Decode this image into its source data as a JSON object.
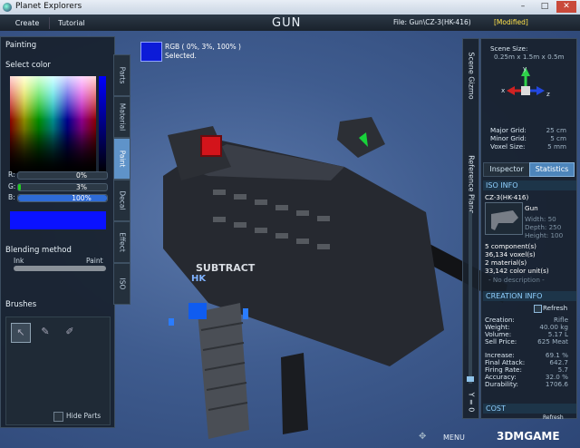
{
  "window": {
    "title": "Planet Explorers"
  },
  "toolbar": {
    "create_label": "Create",
    "tutorial_label": "Tutorial",
    "title": "GUN",
    "file": "File: Gun\\CZ-3(HK-416)",
    "modified": "[Modified]"
  },
  "color_info": {
    "rgb": "RGB ( 0%, 3%, 100% )",
    "status": "Selected."
  },
  "left_panel": {
    "title": "Painting",
    "select_color": "Select color",
    "r_label": "R:",
    "r_value": "0%",
    "r_level": 0,
    "g_label": "G:",
    "g_value": "3%",
    "g_level": 0.03,
    "b_label": "B:",
    "b_value": "100%",
    "b_level": 1.0,
    "selected_color": "#0a12ff",
    "blending_method": "Blending method",
    "ink_label": "Ink",
    "paint_label": "Paint",
    "brushes_label": "Brushes",
    "hide_parts_label": "Hide Parts"
  },
  "vertical_tabs": [
    "Parts",
    "Material",
    "Paint",
    "Decal",
    "Effect",
    "ISO"
  ],
  "active_tab": "Paint",
  "viewport": {
    "subtract_label": "SUBTRACT",
    "decal_text": "HK"
  },
  "gizmo_strip": {
    "scene_gizmo": "Scene Gizmo",
    "reference_plane": "Reference Plane",
    "y_value": "Y = 0"
  },
  "scene": {
    "scene_size_label": "Scene Size:",
    "scene_size_value": "0.25m x 1.5m x 0.5m",
    "axis_y": "y",
    "axis_x": "x",
    "axis_z": "z",
    "major_grid_label": "Major Grid:",
    "major_grid_value": "25 cm",
    "minor_grid_label": "Minor Grid:",
    "minor_grid_value": "5 cm",
    "voxel_size_label": "Voxel Size:",
    "voxel_size_value": "5 mm"
  },
  "right_tabs": {
    "inspector": "Inspector",
    "statistics": "Statistics"
  },
  "iso_info": {
    "header": "ISO INFO",
    "name": "CZ-3(HK-416)",
    "type": "Gun",
    "width": "Width: 50",
    "depth": "Depth: 250",
    "height": "Height: 100",
    "components": "5 component(s)",
    "voxels": "36,134 voxel(s)",
    "materials": "2 material(s)",
    "color_units": "33,142 color unit(s)",
    "description_placeholder": "- No description -"
  },
  "creation_info": {
    "header": "CREATION INFO",
    "refresh_label": "Refresh",
    "rows": [
      {
        "label": "Creation:",
        "value": "Rifle"
      },
      {
        "label": "Weight:",
        "value": "40.00 kg"
      },
      {
        "label": "Volume:",
        "value": "5.17 L"
      },
      {
        "label": "Sell Price:",
        "value": "625 Meat"
      }
    ],
    "stats": [
      {
        "label": "Increase:",
        "value": "69.1 %"
      },
      {
        "label": "Final Attack:",
        "value": "642.7"
      },
      {
        "label": "Firing Rate:",
        "value": "5.7"
      },
      {
        "label": "Accuracy:",
        "value": "32.0 %"
      },
      {
        "label": "Durability:",
        "value": "1706.6"
      }
    ]
  },
  "cost": {
    "header": "COST",
    "refresh_label": "Refresh"
  },
  "bottom": {
    "menu_label": "MENU",
    "watermark": "3DMGAME"
  }
}
